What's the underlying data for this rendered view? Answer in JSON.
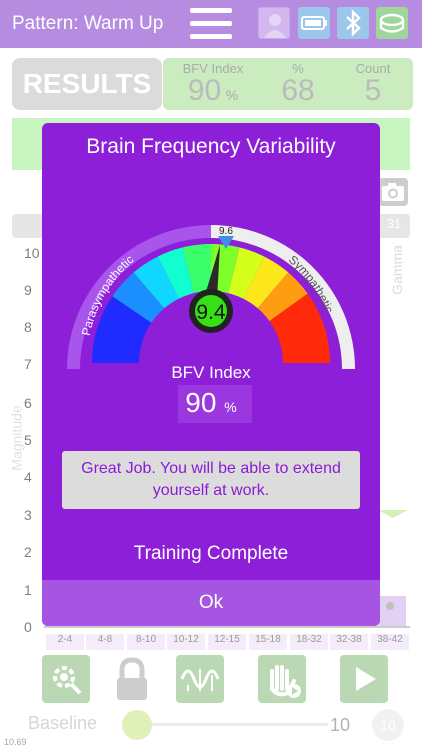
{
  "header": {
    "title": "Pattern: Warm Up",
    "menu_icon": "hamburger-menu-icon",
    "icons": [
      "avatar-icon",
      "battery-icon",
      "bluetooth-icon",
      "headset-icon"
    ]
  },
  "results": {
    "label": "RESULTS",
    "stats": [
      {
        "label": "BFV Index",
        "value": "90",
        "unit": "%"
      },
      {
        "label": "%",
        "value": "68",
        "unit": ""
      },
      {
        "label": "Count",
        "value": "5",
        "unit": ""
      }
    ]
  },
  "background_chart": {
    "y_ticks": [
      "10",
      "9",
      "8",
      "7",
      "6",
      "5",
      "4",
      "3",
      "2",
      "1",
      "0"
    ],
    "y_axis_label": "Magnitude",
    "right_label": "Gamma",
    "tab_number": "31",
    "x_ticks": [
      "2-4",
      "4-8",
      "8-10",
      "10-12",
      "12-15",
      "15-18",
      "18-32",
      "32-38",
      "38-42"
    ]
  },
  "toolbar": {
    "buttons": [
      "settings-search-icon",
      "lock-icon",
      "waveform-icon",
      "hand-play-icon",
      "play-icon"
    ],
    "baseline_label": "Baseline",
    "slider_value": 10,
    "slider_value_text": "10",
    "slider_circle_text": "10",
    "version": "10.69"
  },
  "modal": {
    "title": "Brain Frequency Variability",
    "gauge": {
      "left_label": "Parasympathetic",
      "right_label": "Sympathetic",
      "marker_value": "9.6",
      "center_value": "9.4",
      "needle_value": 9.4,
      "range": [
        0,
        20
      ]
    },
    "bfv_label": "BFV Index",
    "bfv_value": "90",
    "bfv_unit": "%",
    "message": "Great Job. You will be able to extend yourself at work.",
    "status": "Training Complete",
    "ok_label": "Ok"
  },
  "colors": {
    "header": "#b58ce0",
    "modal": "#8e1fd9",
    "results_green": "#b8e6aa",
    "ok_bar": "#a655e2",
    "message_text": "#8b1bd6"
  }
}
